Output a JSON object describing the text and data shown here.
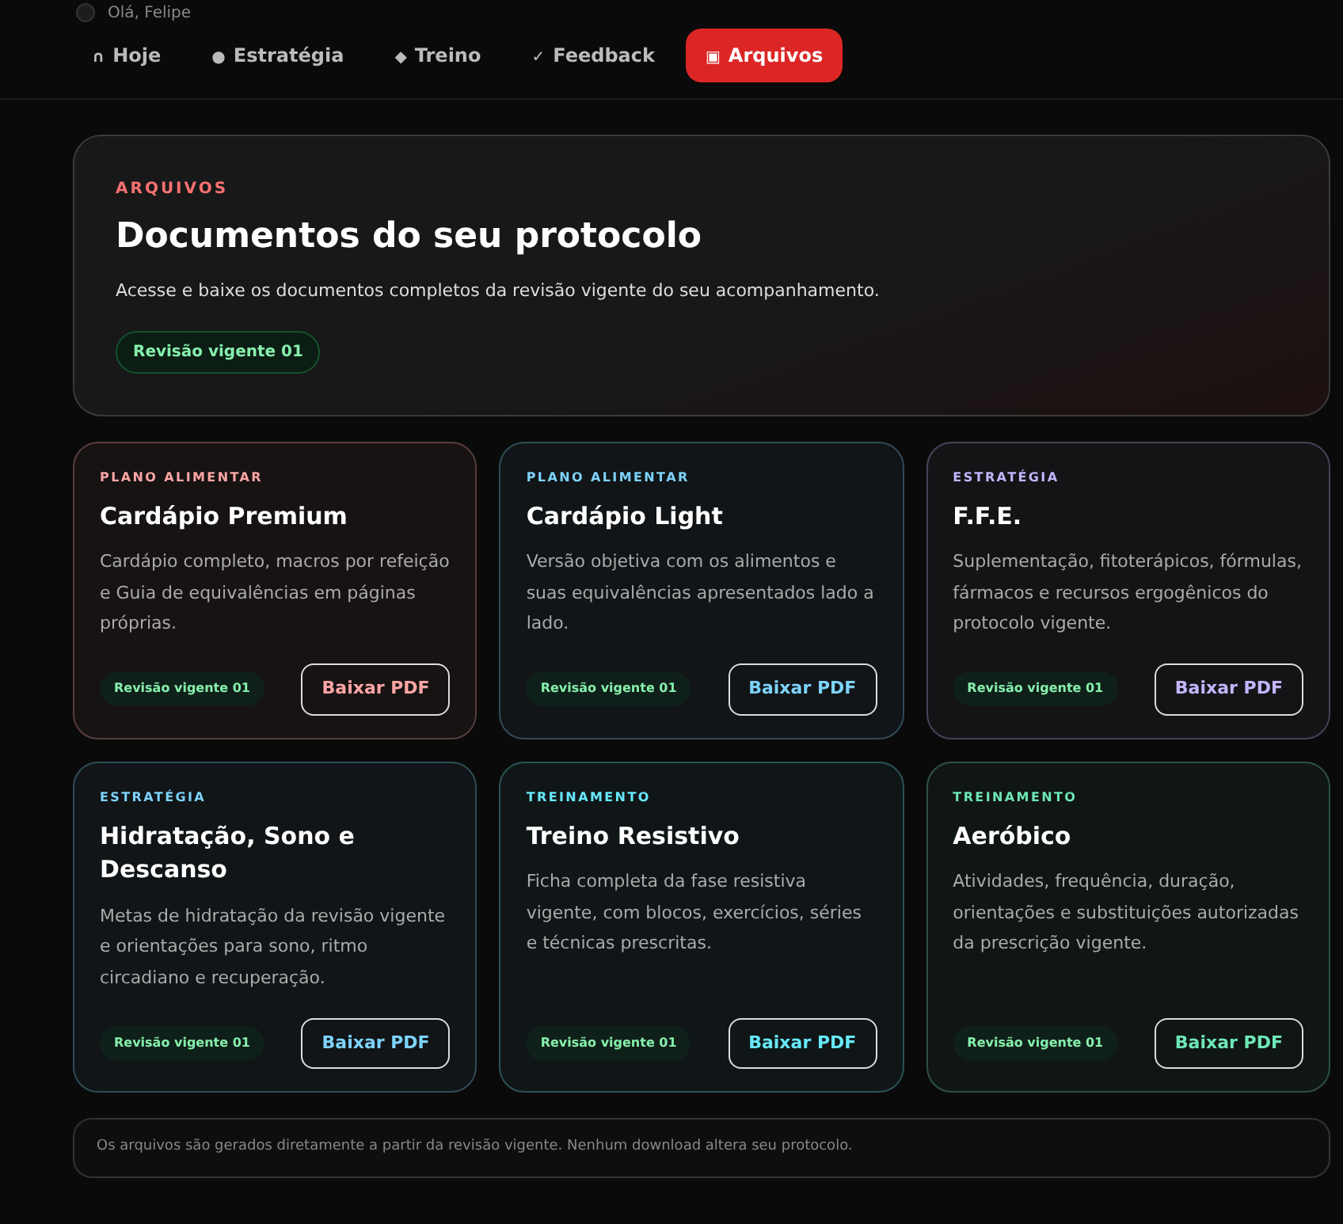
{
  "header": {
    "greeting": "Olá, Felipe"
  },
  "tabs": [
    {
      "icon": "∩",
      "label": "Hoje",
      "selected": false
    },
    {
      "icon": "●",
      "label": "Estratégia",
      "selected": false
    },
    {
      "icon": "◆",
      "label": "Treino",
      "selected": false
    },
    {
      "icon": "✓",
      "label": "Feedback",
      "selected": false
    },
    {
      "icon": "▣",
      "label": "Arquivos",
      "selected": true
    }
  ],
  "hero": {
    "eyebrow": "ARQUIVOS",
    "title": "Documentos do seu protocolo",
    "description": "Acesse e baixe os documentos completos da revisão vigente do seu acompanhamento.",
    "badge": "Revisão vigente 01"
  },
  "cards": [
    {
      "category": "PLANO ALIMENTAR",
      "title": "Cardápio Premium",
      "description": "Cardápio completo, macros por refeição e Guia de equivalências em páginas próprias.",
      "badge": "Revisão vigente 01",
      "button": "Baixar PDF",
      "color": "#fca5a5"
    },
    {
      "category": "PLANO ALIMENTAR",
      "title": "Cardápio Light",
      "description": "Versão objetiva com os alimentos e suas equivalências apresentados lado a lado.",
      "badge": "Revisão vigente 01",
      "button": "Baixar PDF",
      "color": "#7dd3fc"
    },
    {
      "category": "ESTRATÉGIA",
      "title": "F.F.E.",
      "description": "Suplementação, fitoterápicos, fórmulas, fármacos e recursos ergogênicos do protocolo vigente.",
      "badge": "Revisão vigente 01",
      "button": "Baixar PDF",
      "color": "#c4b5fd"
    },
    {
      "category": "ESTRATÉGIA",
      "title": "Hidratação, Sono e Descanso",
      "description": "Metas de hidratação da revisão vigente e orientações para sono, ritmo circadiano e recuperação.",
      "badge": "Revisão vigente 01",
      "button": "Baixar PDF",
      "color": "#7dd3fc"
    },
    {
      "category": "TREINAMENTO",
      "title": "Treino Resistivo",
      "description": "Ficha completa da fase resistiva vigente, com blocos, exercícios, séries e técnicas prescritas.",
      "badge": "Revisão vigente 01",
      "button": "Baixar PDF",
      "color": "#67e8f9"
    },
    {
      "category": "TREINAMENTO",
      "title": "Aeróbico",
      "description": "Atividades, frequência, duração, orientações e substituições autorizadas da prescrição vigente.",
      "badge": "Revisão vigente 01",
      "button": "Baixar PDF",
      "color": "#6ee7b7"
    }
  ],
  "footer_note": "Os arquivos são gerados diretamente a partir da revisão vigente. Nenhum download altera seu protocolo."
}
